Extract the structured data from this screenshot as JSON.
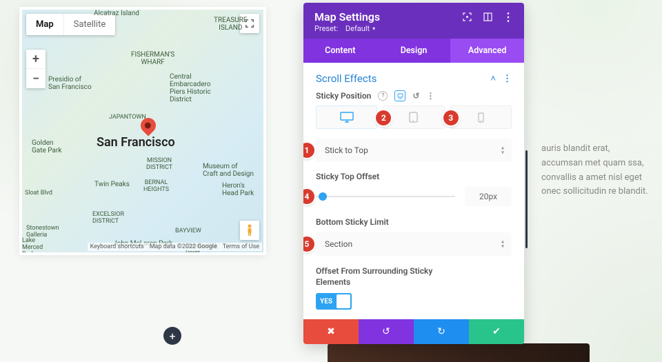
{
  "map": {
    "typeButtons": {
      "map": "Map",
      "satellite": "Satellite"
    },
    "centerLabel": "San Francisco",
    "pois": {
      "alcatraz": "Alcatraz Island",
      "treasure": "TREASURE\nISLAND",
      "presidio": "Presidio of\nSan Francisco",
      "fishermans": "FISHERMAN'S\nWHARF",
      "embarcadero": "Central\nEmbarcadero\nPiers Historic\nDistrict",
      "japantown": "JAPANTOWN",
      "goldengate": "Golden\nGate Park",
      "mission": "MISSION\nDISTRICT",
      "museum": "Museum of\nCraft and Design",
      "twinpeaks": "Twin Peaks",
      "bernal": "BERNAL\nHEIGHTS",
      "heron": "Heron's\nHead Park",
      "excelsior": "EXCELSIOR\nDISTRICT",
      "bayview": "BAYVIEW",
      "stonestown": "Stonestown\nGalleria",
      "lakemerced": "Lake\nMerced\nPark",
      "mclaren": "John McLaren Park",
      "sloat": "Sloat Blvd",
      "candlestick": "Candlestick\nPoint"
    },
    "footer": {
      "shortcuts": "Keyboard shortcuts",
      "data": "Map data ©2022 Google",
      "terms": "Terms of Use"
    }
  },
  "textBlock": "auris blandit erat, accumsan met quam ssa, convallis a amet nisl eget onec sollicitudin re blandit.",
  "panel": {
    "title": "Map Settings",
    "presetPrefix": "Preset:",
    "presetValue": "Default",
    "tabs": {
      "content": "Content",
      "design": "Design",
      "advanced": "Advanced"
    },
    "section": {
      "title": "Scroll Effects",
      "stickyPositionLabel": "Sticky Position",
      "stickTo": {
        "value": "Stick to Top"
      },
      "topOffset": {
        "label": "Sticky Top Offset",
        "value": "20px"
      },
      "bottomLimit": {
        "label": "Bottom Sticky Limit",
        "value": "Section"
      },
      "offsetSurrounding": {
        "label": "Offset From Surrounding Sticky Elements",
        "toggle": "YES"
      }
    }
  },
  "annotations": {
    "a1": "1",
    "a2": "2",
    "a3": "3",
    "a4": "4",
    "a5": "5"
  }
}
